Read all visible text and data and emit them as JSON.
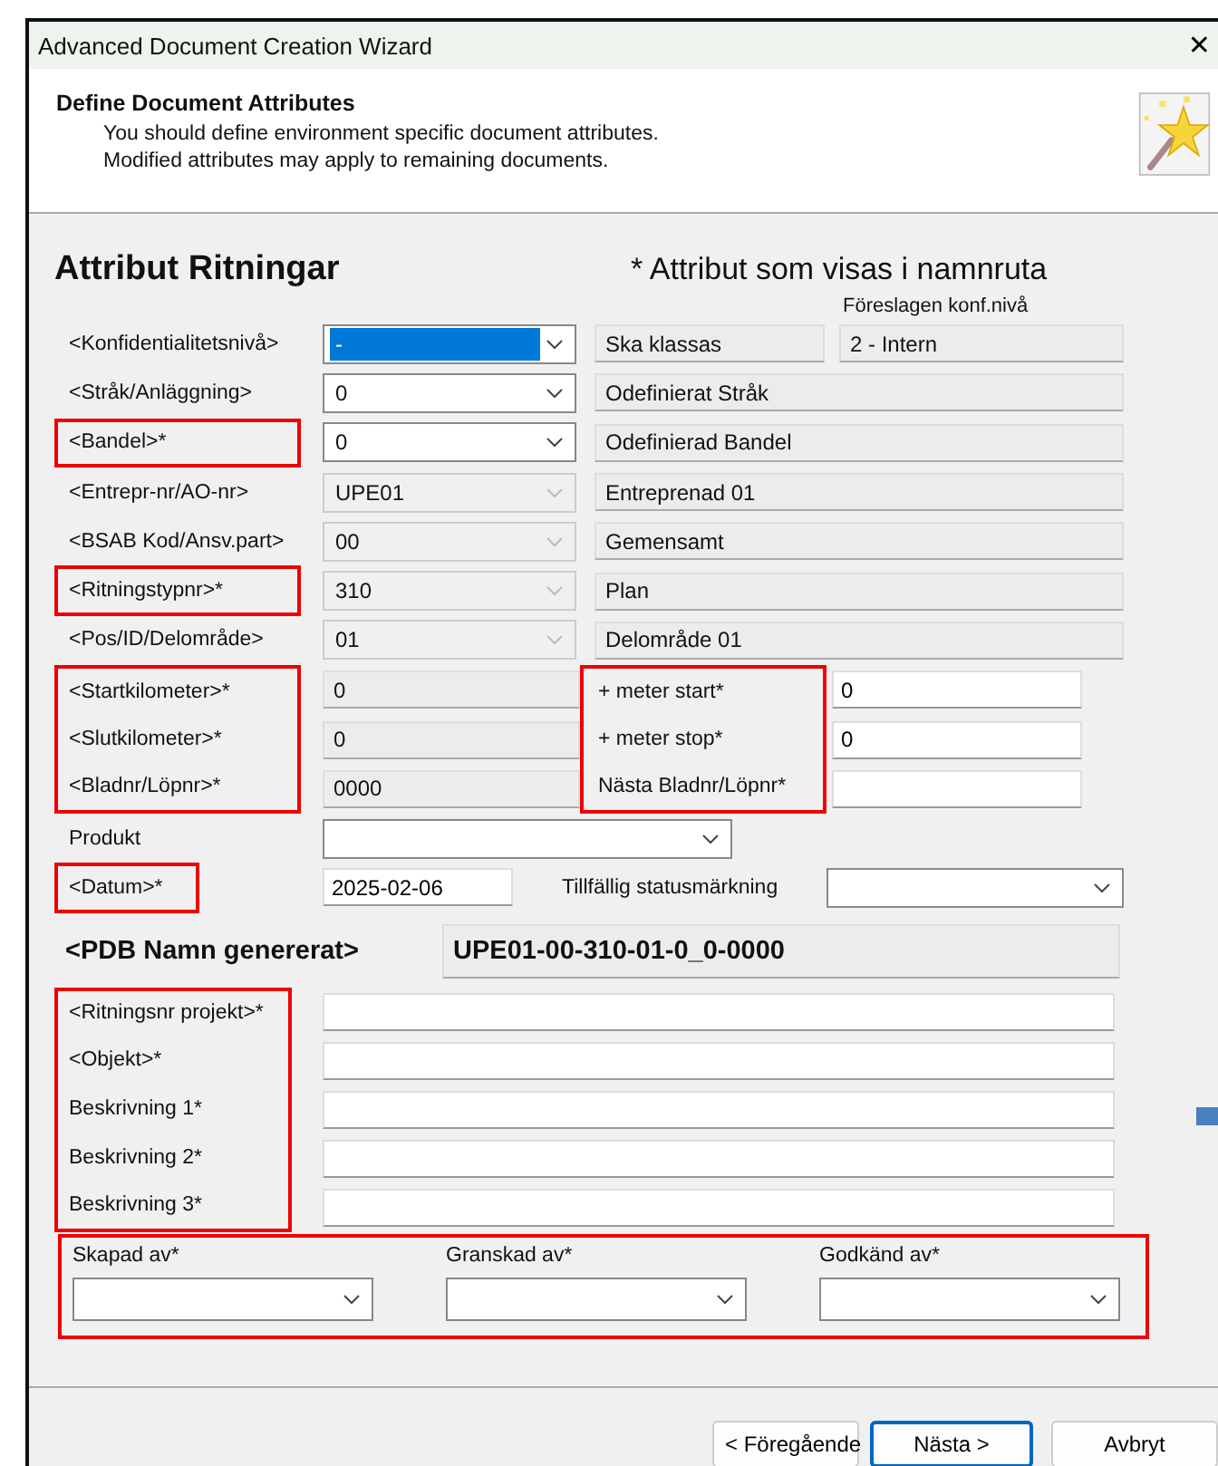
{
  "window": {
    "title": "Advanced Document Creation Wizard",
    "close": "✕"
  },
  "header": {
    "title": "Define Document Attributes",
    "lines": [
      "You should define environment specific document attributes.",
      "Modified attributes may apply to remaining documents."
    ]
  },
  "form": {
    "heading": "Attribut Ritningar",
    "note": "* Attribut som visas i namnruta",
    "suggested_label": "Föreslagen konf.nivå",
    "combo_rows": [
      {
        "label": "<Konfidentialitetsnivå>",
        "highlighted": false,
        "value": "-",
        "enabled": true,
        "selected": true,
        "description": "Ska klassas",
        "suggested": "2 - Intern"
      },
      {
        "label": "<Stråk/Anläggning>",
        "highlighted": false,
        "value": "0",
        "enabled": true,
        "selected": false,
        "description": "Odefinierat Stråk"
      },
      {
        "label": "<Bandel>*",
        "highlighted": true,
        "value": "0",
        "enabled": true,
        "selected": false,
        "description": "Odefinierad Bandel"
      },
      {
        "label": "<Entrepr-nr/AO-nr>",
        "highlighted": false,
        "value": "UPE01",
        "enabled": false,
        "selected": false,
        "description": "Entreprenad 01"
      },
      {
        "label": "<BSAB Kod/Ansv.part>",
        "highlighted": false,
        "value": "00",
        "enabled": false,
        "selected": false,
        "description": "Gemensamt"
      },
      {
        "label": "<Ritningstypnr>*",
        "highlighted": true,
        "value": "310",
        "enabled": false,
        "selected": false,
        "description": "Plan"
      },
      {
        "label": "<Pos/ID/Delområde>",
        "highlighted": false,
        "value": "01",
        "enabled": false,
        "selected": false,
        "description": "Delområde 01"
      }
    ],
    "km_rows": [
      {
        "label": "<Startkilometer>*",
        "highlighted": true,
        "value": "0",
        "side_label": "+ meter start*",
        "side_highlighted": true,
        "side_value": "0"
      },
      {
        "label": "<Slutkilometer>*",
        "highlighted": true,
        "value": "0",
        "side_label": "+ meter stop*",
        "side_highlighted": true,
        "side_value": "0"
      },
      {
        "label": "<Bladnr/Löpnr>*",
        "highlighted": true,
        "value": "0000",
        "side_label": "Nästa Bladnr/Löpnr*",
        "side_highlighted": true
      }
    ],
    "produkt": {
      "label": "Produkt",
      "highlighted": false
    },
    "datum": {
      "label": "<Datum>*",
      "highlighted": true,
      "value": "2025-02-06",
      "status_label": "Tillfällig statusmärkning"
    },
    "pdb": {
      "label": "<PDB Namn genererat>",
      "value": "UPE01-00-310-01-0_0-0000"
    },
    "text_rows": [
      {
        "label": "<Ritningsnr projekt>*",
        "highlighted": true
      },
      {
        "label": "<Objekt>*",
        "highlighted": true
      },
      {
        "label": "Beskrivning 1*",
        "highlighted": true
      },
      {
        "label": "Beskrivning 2*",
        "highlighted": true
      },
      {
        "label": "Beskrivning 3*",
        "highlighted": true
      }
    ],
    "signers": {
      "highlighted": true,
      "items": [
        {
          "label": "Skapad av*"
        },
        {
          "label": "Granskad av*"
        },
        {
          "label": "Godkänd av*"
        }
      ]
    }
  },
  "buttons": [
    {
      "label": "< Föregående",
      "default": false
    },
    {
      "label": "Nästa >",
      "default": true
    },
    {
      "label": "Avbryt",
      "default": false
    }
  ]
}
